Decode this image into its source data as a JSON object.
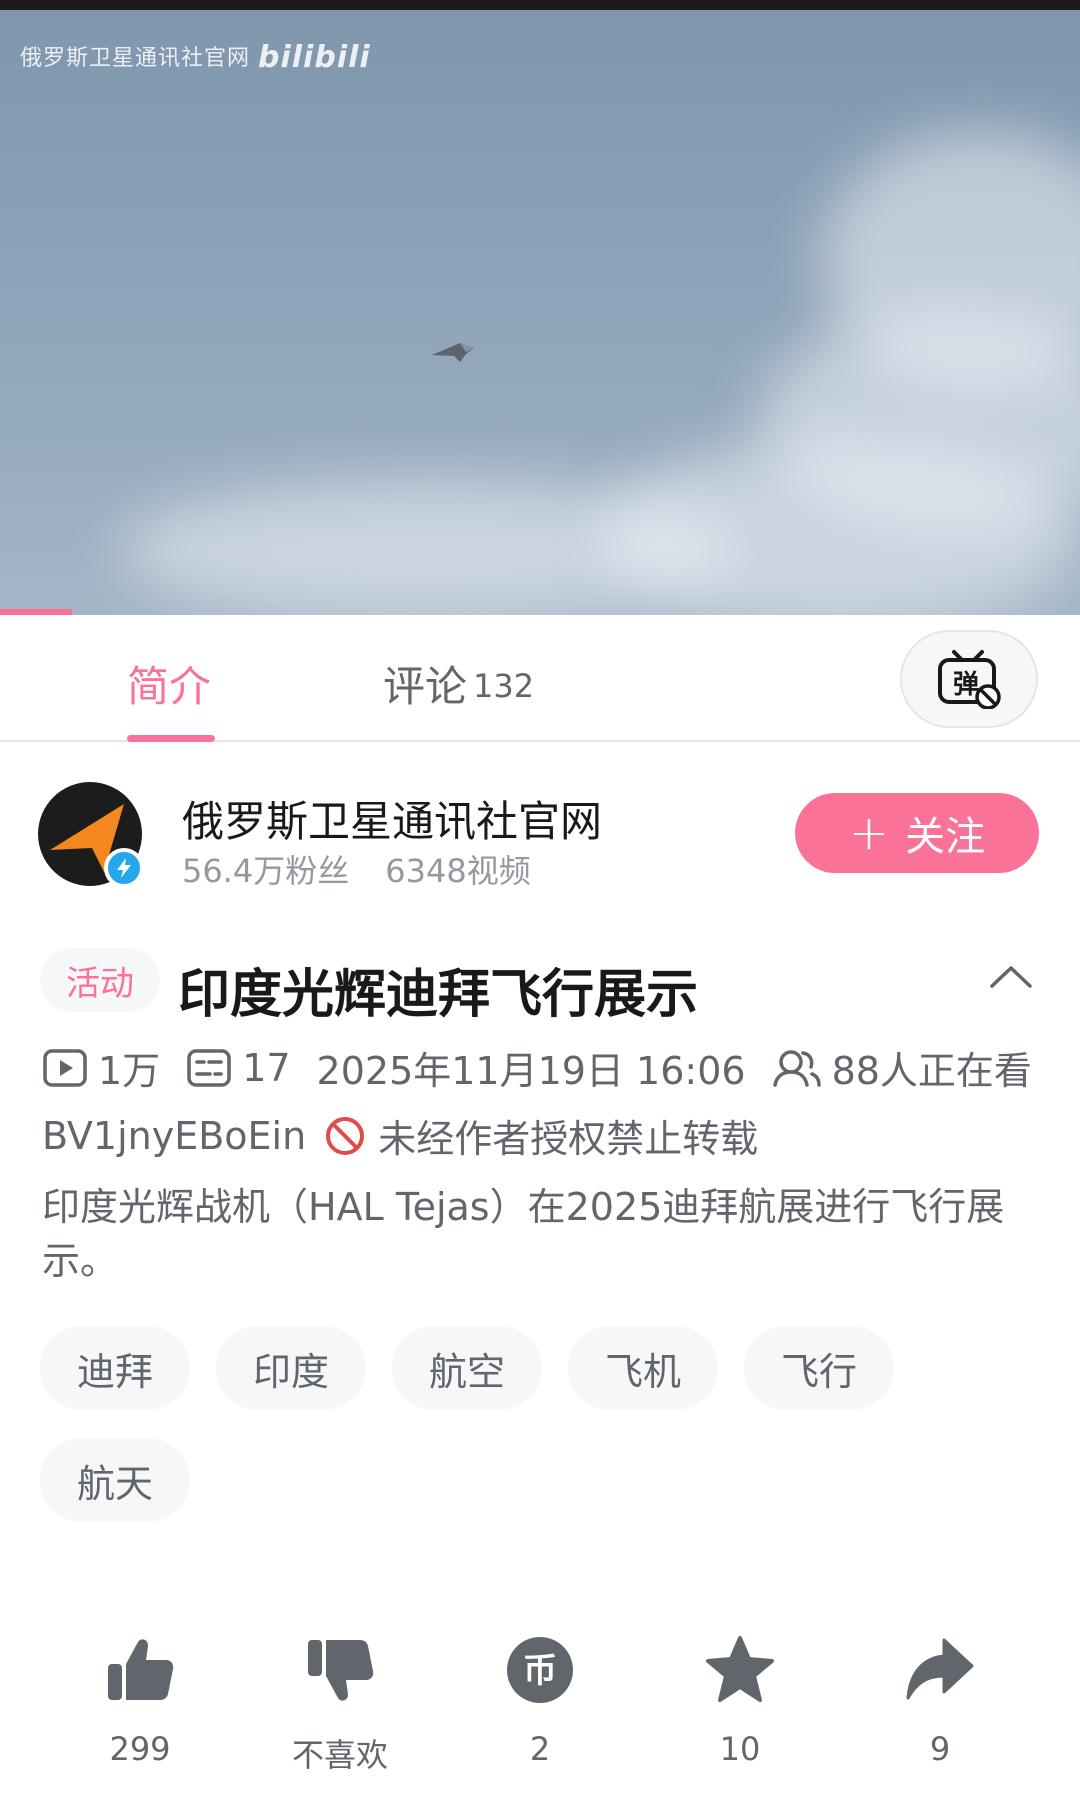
{
  "player": {
    "watermark_text": "俄罗斯卫星通讯社官网",
    "watermark_logo": "bilibili",
    "progress_fraction": 0.067
  },
  "tabs": [
    {
      "label": "简介",
      "active": true
    },
    {
      "label": "评论",
      "count": "132",
      "active": false
    }
  ],
  "danmaku_toggle": {
    "icon": "danmaku-off-icon",
    "glyph": "弹"
  },
  "uploader": {
    "name": "俄罗斯卫星通讯社官网",
    "fans": "56.4万粉丝",
    "videos": "6348视频",
    "follow_label": "关注",
    "follow_plus": "+"
  },
  "video": {
    "badge": "活动",
    "title": "印度光辉迪拜飞行展示",
    "views": "1万",
    "danmaku_count": "17",
    "publish_time": "2025年11月19日 16:06",
    "watching": "88人正在看",
    "bvid": "BV1jnyEBoEin",
    "repost_notice": "未经作者授权禁止转载",
    "description": "印度光辉战机（HAL Tejas）在2025迪拜航展进行飞行展示。"
  },
  "tags": [
    "迪拜",
    "印度",
    "航空",
    "飞机",
    "飞行",
    "航天"
  ],
  "actions": [
    {
      "name": "like",
      "icon": "thumbs-up-icon",
      "label": "299"
    },
    {
      "name": "dislike",
      "icon": "thumbs-down-icon",
      "label": "不喜欢"
    },
    {
      "name": "coin",
      "icon": "coin-icon",
      "glyph": "币",
      "label": "2"
    },
    {
      "name": "favorite",
      "icon": "star-icon",
      "label": "10"
    },
    {
      "name": "share",
      "icon": "share-icon",
      "label": "9"
    }
  ],
  "colors": {
    "accent": "#fb7299",
    "text_primary": "#18191c",
    "text_secondary": "#61666d",
    "text_muted": "#9499a0",
    "chip_bg": "#f6f7f8",
    "verify_blue": "#25a7ec",
    "forbid_red": "#e34a4a"
  }
}
